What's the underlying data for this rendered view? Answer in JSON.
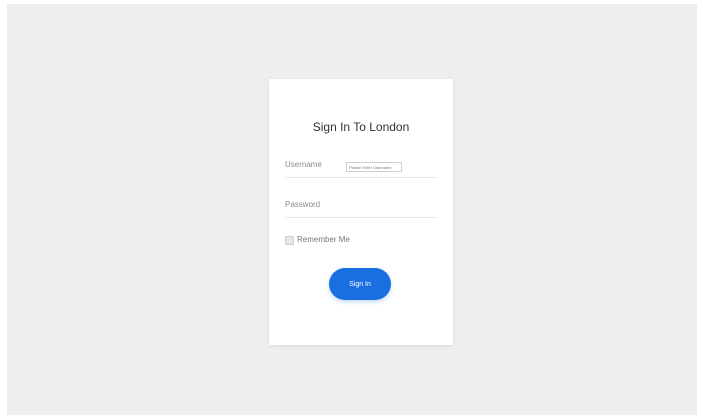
{
  "login": {
    "title": "Sign In To London",
    "username_label": "Username",
    "username_placeholder": "Please Enter Username",
    "password_label": "Password",
    "password_placeholder": "",
    "remember_label": "Remember Me",
    "signin_label": "Sign In"
  },
  "colors": {
    "page_background": "#eeeeee",
    "card_background": "#ffffff",
    "accent": "#1a6fe0"
  }
}
